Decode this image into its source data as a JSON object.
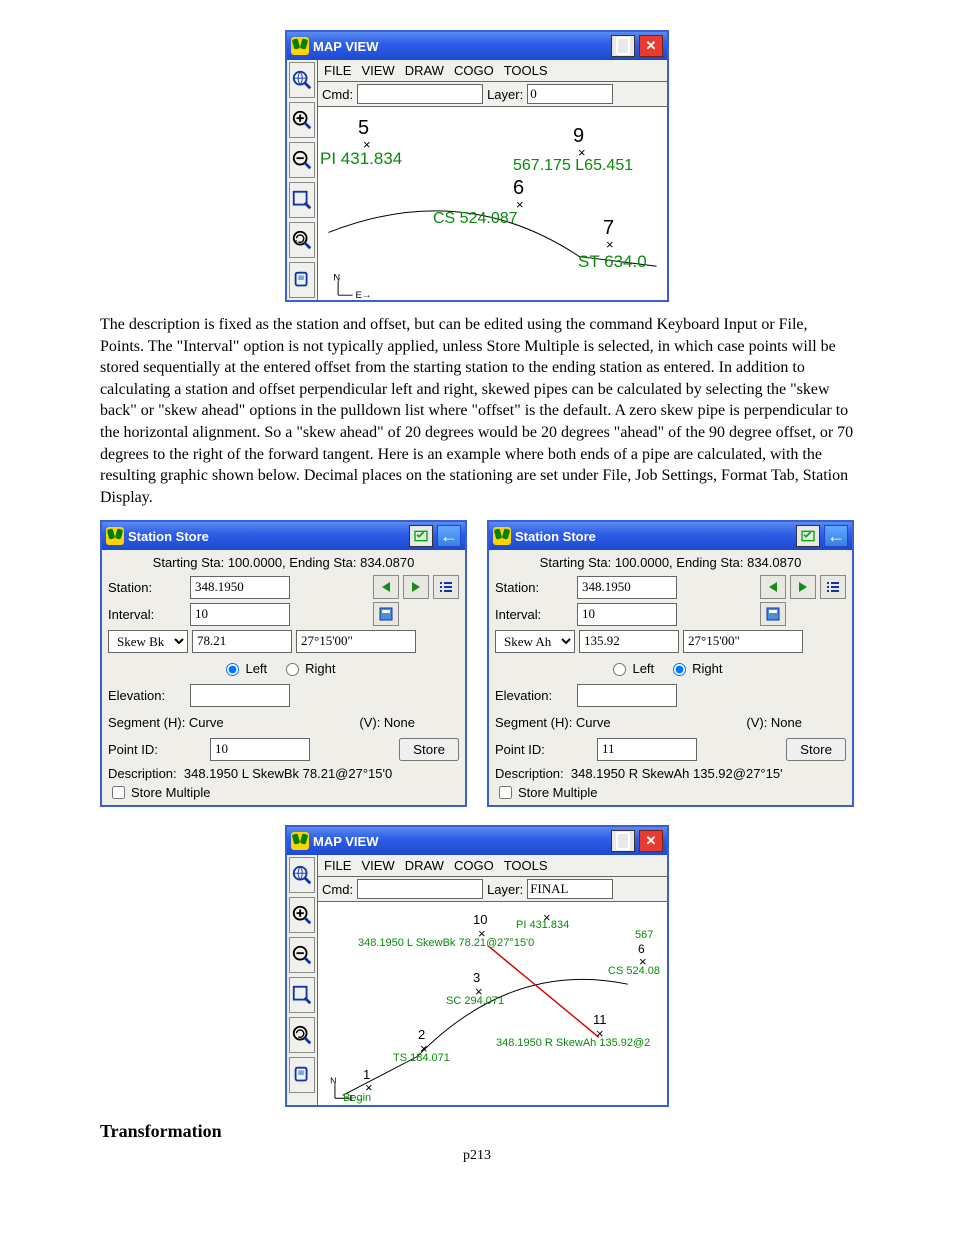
{
  "mapview1": {
    "title": "MAP VIEW",
    "menu": [
      "FILE",
      "VIEW",
      "DRAW",
      "COGO",
      "TOOLS"
    ],
    "cmd_label": "Cmd:",
    "cmd_value": "",
    "layer_label": "Layer:",
    "layer_value": "0",
    "tools": [
      "zoom-world-icon",
      "zoom-in-icon",
      "zoom-out-icon",
      "zoom-extents-icon",
      "zoom-prev-icon",
      "pan-icon"
    ],
    "labels": {
      "p5": "5",
      "p5x": "×",
      "pi": "PI 431.834",
      "p9": "9",
      "p9x": "×",
      "seg": "567.175 L65.451",
      "p6": "6",
      "p6x": "×",
      "cs": "CS 524.087",
      "p7": "7",
      "p7x": "×",
      "st": "ST 634.0"
    }
  },
  "paragraph": "The description is fixed as the station and offset, but can be edited using the command Keyboard Input or File, Points.  The \"Interval\" option is not typically applied, unless Store Multiple is selected, in which case points will be stored sequentially at the entered offset from the starting station to the ending station as entered.  In addition to calculating a station and offset perpendicular left and right, skewed pipes can be calculated by selecting the \"skew back\" or \"skew ahead\" options in the pulldown list where \"offset\" is the default.  A zero skew pipe is perpendicular to the horizontal alignment.  So a \"skew ahead\" of 20 degrees would be 20 degrees \"ahead\" of the 90 degree offset, or 70 degrees to the right of the forward tangent.  Here is an example where both ends of a pipe are calculated, with the resulting graphic shown below.  Decimal places on the stationing are set under File, Job Settings, Format Tab, Station Display.",
  "ss": {
    "title": "Station Store",
    "header": "Starting Sta: 100.0000, Ending Sta: 834.0870",
    "station_label": "Station:",
    "interval_label": "Interval:",
    "left": "Left",
    "right": "Right",
    "elevation": "Elevation:",
    "segH": "Segment (H): Curve",
    "segV": "(V): None",
    "pointid": "Point ID:",
    "store": "Store",
    "desc_label": "Description:",
    "store_multiple": "Store Multiple"
  },
  "ss_left": {
    "station": "348.1950",
    "interval": "10",
    "skew_type": "Skew Bk",
    "skew_val": "78.21",
    "skew_ang": "27°15'00\"",
    "side": "left",
    "elevation": "",
    "pointid": "10",
    "description": "348.1950 L SkewBk 78.21@27°15'0"
  },
  "ss_right": {
    "station": "348.1950",
    "interval": "10",
    "skew_type": "Skew Ah",
    "skew_val": "135.92",
    "skew_ang": "27°15'00\"",
    "side": "right",
    "elevation": "",
    "pointid": "11",
    "description": "348.1950 R SkewAh 135.92@27°15'"
  },
  "mapview2": {
    "title": "MAP VIEW",
    "menu": [
      "FILE",
      "VIEW",
      "DRAW",
      "COGO",
      "TOOLS"
    ],
    "cmd_label": "Cmd:",
    "cmd_value": "",
    "layer_label": "Layer:",
    "layer_value": "FINAL",
    "labels": {
      "p10": "10",
      "l10": "348.1950 L SkewBk 78.21@27°15'0",
      "pi": "PI 431.834",
      "p567": "567",
      "p6": "6",
      "cs": "CS 524.08",
      "p3": "3",
      "sc": "SC 294.071",
      "p11": "11",
      "l11": "348.1950 R SkewAh 135.92@2",
      "p2": "2",
      "ts": "TS 184.071",
      "p1": "1",
      "begin": "Begin"
    }
  },
  "section": "Transformation",
  "pagenum": "p213"
}
